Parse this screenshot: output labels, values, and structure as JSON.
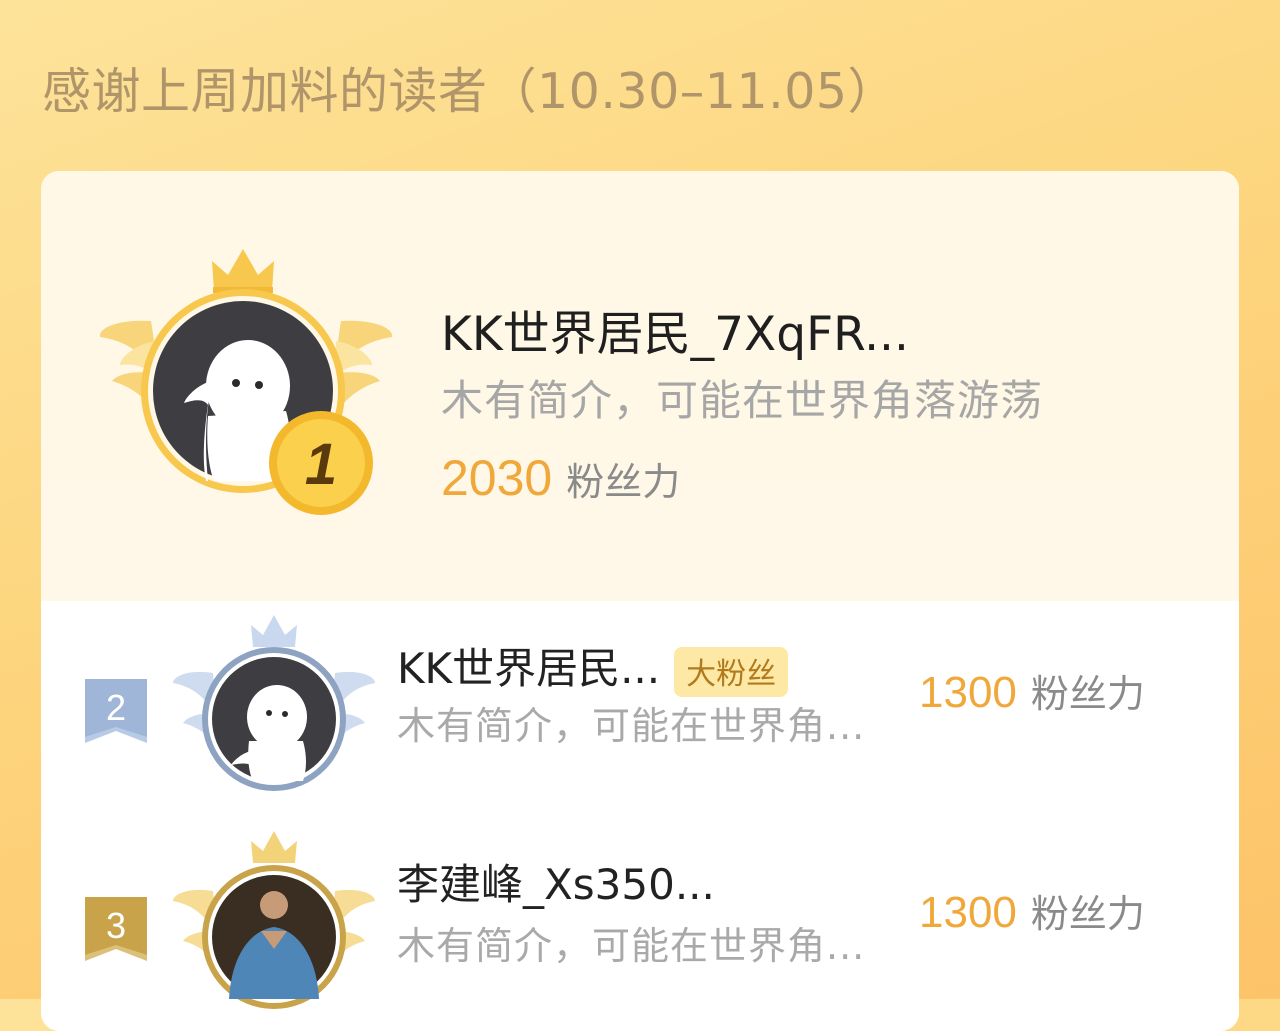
{
  "header": {
    "title": "感谢上周加料的读者（10.30–11.05）"
  },
  "top_reader": {
    "rank": "1",
    "name": "KK世界居民_7XqFR...",
    "intro": "木有简介，可能在世界角落游荡",
    "score": "2030",
    "score_unit": "粉丝力"
  },
  "readers": [
    {
      "rank": "2",
      "name": "KK世界居民...",
      "badge": "大粉丝",
      "intro": "木有简介，可能在世界角...",
      "score": "1300",
      "score_unit": "粉丝力"
    },
    {
      "rank": "3",
      "name": "李建峰_Xs350...",
      "intro": "木有简介，可能在世界角...",
      "score": "1300",
      "score_unit": "粉丝力"
    }
  ],
  "colors": {
    "accent_orange": "#f1a83a",
    "gold": "#f6c54a",
    "silver": "#8ea3c2",
    "bronze": "#c9a34a"
  },
  "icons": [
    "crown-icon",
    "wings-icon",
    "rank-medal-icon",
    "rank-flag-icon",
    "default-avatar-icon"
  ]
}
